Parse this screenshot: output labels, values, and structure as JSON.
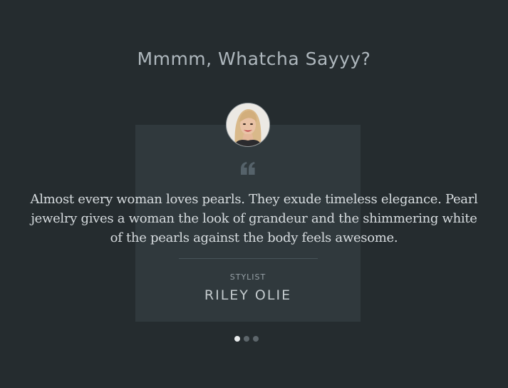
{
  "section": {
    "heading": "Mmmm, Whatcha Sayyy?"
  },
  "testimonial": {
    "quote": "Almost every woman loves pearls. They exude timeless elegance. Pearl jewelry gives a woman the look of grandeur and the shimmering white of the pearls against the body feels awesome.",
    "role": "STYLIST",
    "name": "RILEY OLIE",
    "avatar_icon": "avatar-photo",
    "quote_icon": "quote-icon"
  },
  "carousel": {
    "slides": 3,
    "active_index": 0
  },
  "colors": {
    "background": "#252c2f",
    "card": "#30393d",
    "dot_active": "#e8ebec",
    "dot_inactive": "#5d666b"
  }
}
